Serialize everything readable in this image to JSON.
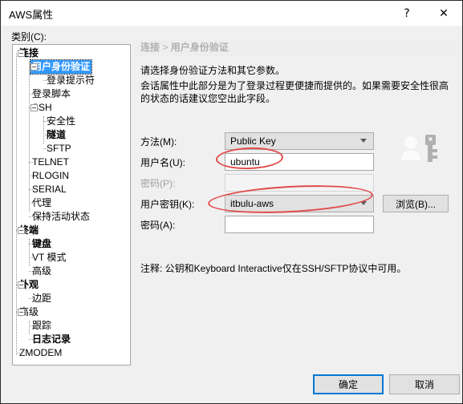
{
  "window": {
    "title": "AWS属性",
    "help_glyph": "?",
    "close_glyph": "✕"
  },
  "sidebar": {
    "label": "类别(C):",
    "items": [
      {
        "label": "连接",
        "level": 0,
        "bold": true,
        "selected": false,
        "expander": true
      },
      {
        "label": "用户身份验证",
        "level": 1,
        "bold": true,
        "selected": true,
        "expander": true
      },
      {
        "label": "登录提示符",
        "level": 2,
        "bold": false,
        "selected": false,
        "expander": false
      },
      {
        "label": "登录脚本",
        "level": 1,
        "bold": false,
        "selected": false,
        "expander": false
      },
      {
        "label": "SSH",
        "level": 1,
        "bold": false,
        "selected": false,
        "expander": true
      },
      {
        "label": "安全性",
        "level": 2,
        "bold": false,
        "selected": false,
        "expander": false
      },
      {
        "label": "隧道",
        "level": 2,
        "bold": true,
        "selected": false,
        "expander": false
      },
      {
        "label": "SFTP",
        "level": 2,
        "bold": false,
        "selected": false,
        "expander": false
      },
      {
        "label": "TELNET",
        "level": 1,
        "bold": false,
        "selected": false,
        "expander": false
      },
      {
        "label": "RLOGIN",
        "level": 1,
        "bold": false,
        "selected": false,
        "expander": false
      },
      {
        "label": "SERIAL",
        "level": 1,
        "bold": false,
        "selected": false,
        "expander": false
      },
      {
        "label": "代理",
        "level": 1,
        "bold": false,
        "selected": false,
        "expander": false
      },
      {
        "label": "保持活动状态",
        "level": 1,
        "bold": false,
        "selected": false,
        "expander": false
      },
      {
        "label": "终端",
        "level": 0,
        "bold": true,
        "selected": false,
        "expander": true
      },
      {
        "label": "键盘",
        "level": 1,
        "bold": true,
        "selected": false,
        "expander": false
      },
      {
        "label": "VT 模式",
        "level": 1,
        "bold": false,
        "selected": false,
        "expander": false
      },
      {
        "label": "高级",
        "level": 1,
        "bold": false,
        "selected": false,
        "expander": false
      },
      {
        "label": "外观",
        "level": 0,
        "bold": true,
        "selected": false,
        "expander": true
      },
      {
        "label": "边距",
        "level": 1,
        "bold": false,
        "selected": false,
        "expander": false
      },
      {
        "label": "高级",
        "level": 0,
        "bold": false,
        "selected": false,
        "expander": true
      },
      {
        "label": "跟踪",
        "level": 1,
        "bold": false,
        "selected": false,
        "expander": false
      },
      {
        "label": "日志记录",
        "level": 1,
        "bold": true,
        "selected": false,
        "expander": false
      },
      {
        "label": "ZMODEM",
        "level": 0,
        "bold": false,
        "selected": false,
        "expander": false
      }
    ]
  },
  "main": {
    "breadcrumb_parent": "连接",
    "breadcrumb_sep": " > ",
    "breadcrumb_current": "用户身份验证",
    "description_line1": "请选择身份验证方法和其它参数。",
    "description_line2": "会话属性中此部分是为了登录过程更便捷而提供的。如果需要安全性很高的状态的话建议您空出此字段。",
    "fields": {
      "method": {
        "label": "方法(M):",
        "value": "Public Key",
        "control": "combobox"
      },
      "username": {
        "label": "用户名(U):",
        "value": "ubuntu",
        "placeholder": "",
        "control": "textbox"
      },
      "password": {
        "label": "密码(P):",
        "value": "",
        "placeholder": "",
        "control": "textbox",
        "disabled": true
      },
      "user_key": {
        "label": "用户密钥(K):",
        "value": "itbulu-aws",
        "control": "combobox"
      },
      "passphrase": {
        "label": "密码(A):",
        "value": "",
        "placeholder": "",
        "control": "textbox"
      }
    },
    "browse_label": "浏览(B)...",
    "note": "注释: 公钥和Keyboard Interactive仅在SSH/SFTP协议中可用。",
    "auth_icon": "user-key-icon"
  },
  "footer": {
    "ok_label": "确定",
    "cancel_label": "取消"
  },
  "annotations": [
    {
      "name": "username-highlight",
      "shape": "ellipse",
      "color": "#e24a4a"
    },
    {
      "name": "user-key-highlight",
      "shape": "ellipse",
      "color": "#e24a4a"
    }
  ],
  "colors": {
    "accent": "#0078d7",
    "selection": "#3399ff",
    "annotation": "#e24a4a",
    "dialog_bg": "#f0f0f0"
  }
}
